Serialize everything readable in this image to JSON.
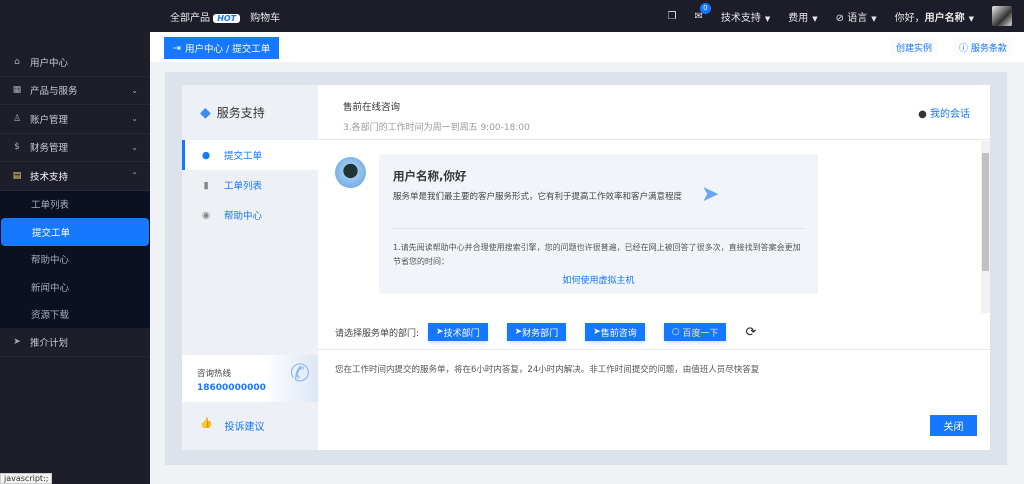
{
  "topbar": {
    "all_products": "全部产品",
    "hot": "HOT",
    "cart": "购物车",
    "msg_count": "0",
    "tech_support": "技术支持",
    "fees": "费用",
    "language": "语言",
    "greeting": "你好，",
    "username": "用户名称"
  },
  "sidebar": {
    "items": [
      {
        "label": "用户中心",
        "icon": "home-icon"
      },
      {
        "label": "产品与服务",
        "icon": "grid-icon"
      },
      {
        "label": "账户管理",
        "icon": "user-icon"
      },
      {
        "label": "财务管理",
        "icon": "dollar-icon"
      },
      {
        "label": "技术支持",
        "icon": "ticket-icon"
      }
    ],
    "sub": [
      "工单列表",
      "提交工单",
      "帮助中心",
      "新闻中心",
      "资源下载"
    ],
    "referral": "推介计划"
  },
  "breadcrumb": "用户中心 / 提交工单",
  "header_actions": {
    "create_instance": "创建实例",
    "service_terms": "服务条款"
  },
  "panel": {
    "brand": "服务支持",
    "nav": [
      "提交工单",
      "工单列表",
      "帮助中心"
    ],
    "hotline_label": "咨询热线",
    "hotline": "18600000000",
    "complaint": "投诉建议"
  },
  "main": {
    "title": "售前在线咨询",
    "subtitle": "3.各部门的工作时间为周一到周五 9:00-18:00",
    "my_sessions": "我的会话",
    "greeting": "用户名称,你好",
    "intro": "服务单是我们最主要的客户服务形式，它有利于提高工作效率和客户满意程度",
    "tip": "1.请先阅读帮助中心并合理使用搜索引擎，您的问题也许很普遍，已经在网上被回答了很多次，直接找到答案会更加节省您的时间：",
    "tip_link": "如何使用虚拟主机",
    "dept_label": "请选择服务单的部门:",
    "depts": [
      "技术部门",
      "财务部门",
      "售前咨询"
    ],
    "baidu": "百度一下",
    "notice": "您在工作时间内提交的服务单，将在6小时内答复，24小时内解决。非工作时间提交的问题，由值班人员尽快答复",
    "close": "关闭"
  },
  "status_bar": "javascript:;",
  "colors": {
    "accent": "#1677ff",
    "topbar": "#1c1d29"
  }
}
